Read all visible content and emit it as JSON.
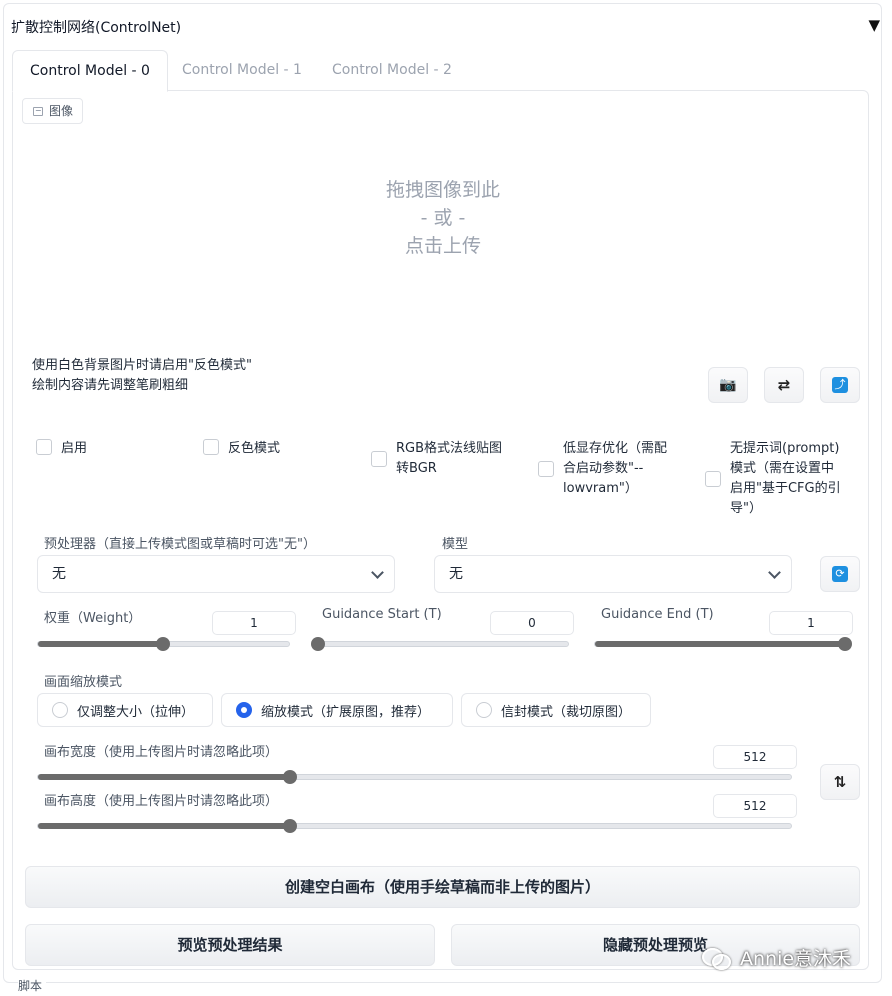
{
  "panel": {
    "title": "扩散控制网络(ControlNet)",
    "collapse_icon": "▼"
  },
  "tabs": [
    "Control Model - 0",
    "Control Model - 1",
    "Control Model - 2"
  ],
  "image_area": {
    "label": "图像",
    "drop_line1": "拖拽图像到此",
    "drop_line2": "- 或 -",
    "drop_line3": "点击上传"
  },
  "hints": {
    "line1": "使用白色背景图片时请启用\"反色模式\"",
    "line2": "绘制内容请先调整笔刷粗细"
  },
  "icons": {
    "camera": "camera-icon",
    "swap": "swap-icon",
    "send": "send-icon",
    "refresh": "refresh-icon",
    "swap_dims": "swap-dimensions-icon"
  },
  "checkboxes": {
    "enable": "启用",
    "invert": "反色模式",
    "rgb_bgr_line1": "RGB格式法线贴图",
    "rgb_bgr_line2": "转BGR",
    "lowvram_line1": "低显存优化（需配",
    "lowvram_line2": "合启动参数\"--",
    "lowvram_line3": "lowvram\"）",
    "guess_line1": "无提示词(prompt)",
    "guess_line2": "模式（需在设置中",
    "guess_line3": "启用\"基于CFG的引",
    "guess_line4": "导\"）"
  },
  "preprocessor": {
    "label": "预处理器（直接上传模式图或草稿时可选\"无\"）",
    "value": "无"
  },
  "model": {
    "label": "模型",
    "value": "无"
  },
  "weight": {
    "label": "权重（Weight）",
    "value": "1",
    "level": 0.5
  },
  "guidance_start": {
    "label": "Guidance Start (T)",
    "value": "0",
    "level": 0.0
  },
  "guidance_end": {
    "label": "Guidance End (T)",
    "value": "1",
    "level": 1.0
  },
  "resize_mode": {
    "label": "画面缩放模式",
    "options": [
      "仅调整大小（拉伸）",
      "缩放模式（扩展原图，推荐）",
      "信封模式（裁切原图）"
    ],
    "selected": 1
  },
  "canvas_width": {
    "label": "画布宽度（使用上传图片时请忽略此项）",
    "value": "512",
    "level": 0.335
  },
  "canvas_height": {
    "label": "画布高度（使用上传图片时请忽略此项）",
    "value": "512",
    "level": 0.335
  },
  "buttons": {
    "create_canvas": "创建空白画布（使用手绘草稿而非上传的图片）",
    "preview": "预览预处理结果",
    "hide_preview": "隐藏预处理预览"
  },
  "watermark": "Annie意沐禾",
  "footer": "脚本"
}
